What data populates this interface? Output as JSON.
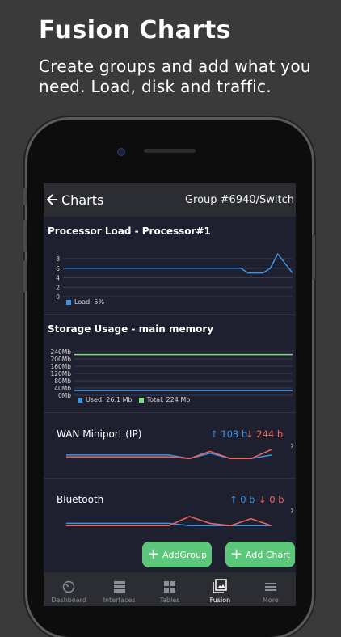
{
  "promo": {
    "title": "Fusion Charts",
    "subtitle": "Create groups and add what you need. Load, disk and traffic."
  },
  "topbar": {
    "back_label": "Charts",
    "group_title": "Group #6940/Switch"
  },
  "processor": {
    "title": "Processor Load  - Processor#1",
    "legend": "Load: 5%",
    "chart_data": {
      "type": "line",
      "y_ticks": [
        "8",
        "6",
        "4",
        "2",
        "0"
      ],
      "ylim": [
        0,
        8
      ],
      "series": [
        {
          "name": "Load: 5%",
          "color": "#3b94e6",
          "values": [
            6,
            6,
            6,
            6,
            6,
            6,
            6,
            6,
            6,
            6,
            6,
            6,
            6,
            6,
            6,
            6,
            6,
            6,
            6,
            6,
            6,
            6,
            6,
            6,
            6,
            5,
            5,
            5,
            6,
            9,
            7,
            5
          ]
        }
      ]
    }
  },
  "storage": {
    "title": "Storage Usage  - main memory",
    "legend_used": "Used: 26.1 Mb",
    "legend_total": "Total: 224 Mb",
    "chart_data": {
      "type": "line",
      "y_ticks": [
        "240Mb",
        "200Mb",
        "160Mb",
        "120Mb",
        "80Mb",
        "40Mb",
        "0Mb"
      ],
      "ylim": [
        0,
        240
      ],
      "series": [
        {
          "name": "Used: 26.1 Mb",
          "color": "#3b94e6",
          "values": [
            26.1,
            26.1
          ]
        },
        {
          "name": "Total: 224 Mb",
          "color": "#7fdc7f",
          "values": [
            224,
            224
          ]
        }
      ]
    }
  },
  "wan": {
    "name": "WAN Miniport (IP)",
    "up": "↑ 103 b",
    "down": "↓ 244 b",
    "chart_data": {
      "type": "line",
      "series": [
        {
          "color": "#3b94e6",
          "values": [
            5,
            5,
            5,
            5,
            5,
            5,
            3,
            6,
            3,
            3,
            5
          ]
        },
        {
          "color": "#f0675a",
          "values": [
            4,
            4,
            4,
            4,
            4,
            4,
            3,
            7,
            3,
            3,
            8
          ]
        }
      ]
    }
  },
  "bluetooth": {
    "name": "Bluetooth",
    "up": "↑ 0 b",
    "down": "↓ 0 b",
    "chart_data": {
      "type": "line",
      "series": [
        {
          "color": "#3b94e6",
          "values": [
            3,
            3,
            3,
            3,
            3,
            3,
            2,
            2,
            2,
            2,
            2
          ]
        },
        {
          "color": "#f0675a",
          "values": [
            2,
            2,
            2,
            2,
            2,
            2,
            6,
            3,
            2,
            5,
            2
          ]
        }
      ]
    }
  },
  "buttons": {
    "add_group": "AddGroup",
    "add_chart": "Add Chart"
  },
  "tabs": [
    {
      "label": "Dashboard",
      "icon": "gauge-icon"
    },
    {
      "label": "Interfaces",
      "icon": "server-icon"
    },
    {
      "label": "Tables",
      "icon": "table-icon"
    },
    {
      "label": "Fusion",
      "icon": "image-icon"
    },
    {
      "label": "More",
      "icon": "menu-icon"
    }
  ],
  "colors": {
    "accent_blue": "#3b94e6",
    "accent_red": "#f0675a",
    "accent_green": "#5cc67a",
    "screen_bg": "#1e2030"
  }
}
